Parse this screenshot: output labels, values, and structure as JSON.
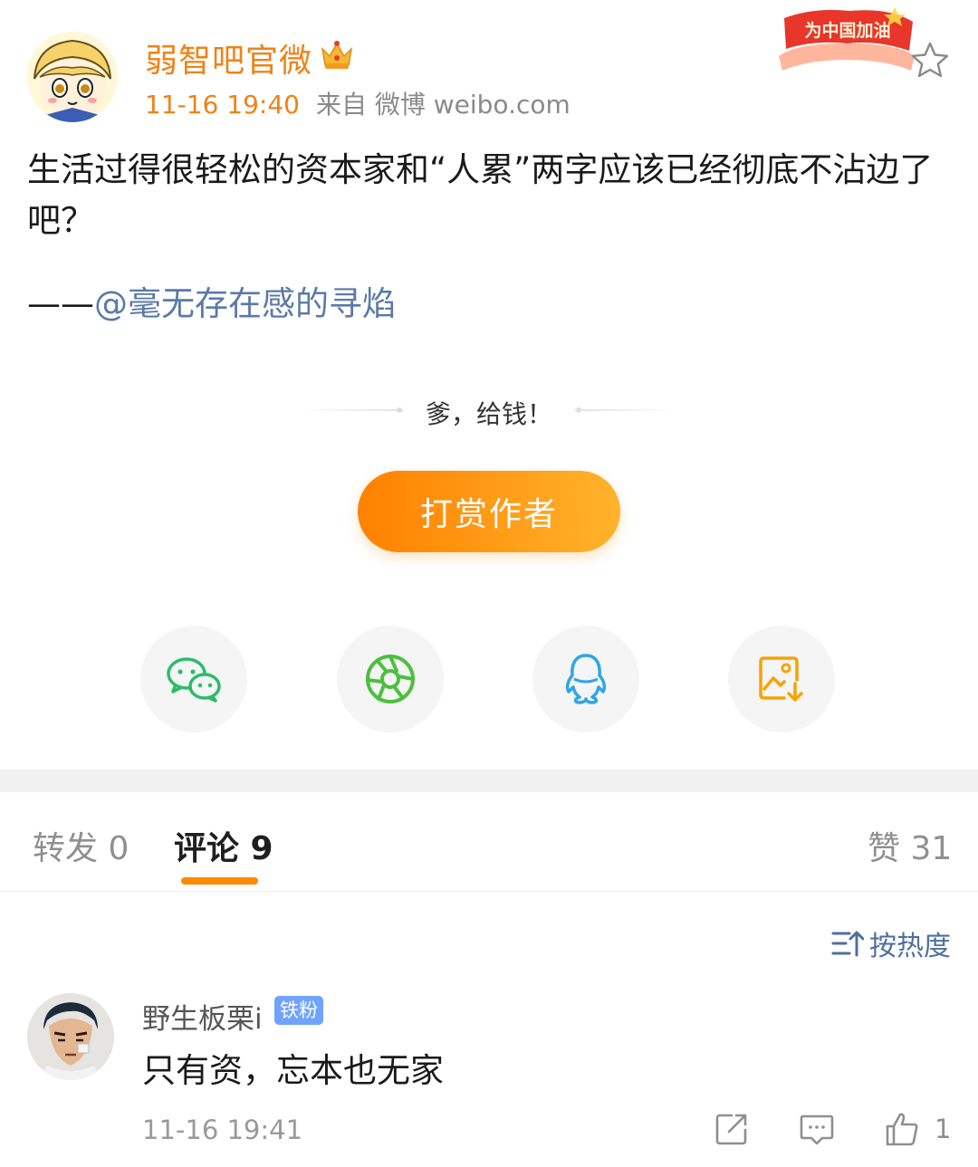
{
  "post": {
    "author": "弱智吧官微",
    "time": "11-16 19:40",
    "source": "来自 微博 weibo.com",
    "badge_text": "为中国加油",
    "text": "生活过得很轻松的资本家和“人累”两字应该已经彻底不沾边了吧？",
    "signature_dash": "——",
    "signature_mention": "@毫无存在感的寻焰"
  },
  "reward": {
    "slogan": "爹，给钱！",
    "button_label": "打赏作者"
  },
  "share": {
    "items": [
      {
        "icon": "wechat-icon",
        "color": "#2dbb6b"
      },
      {
        "icon": "moments-icon",
        "color": "#4cbf3d"
      },
      {
        "icon": "qq-icon",
        "color": "#2fa5e8"
      },
      {
        "icon": "save-image-icon",
        "color": "#f5a400"
      }
    ]
  },
  "tabs": {
    "repost": "转发 0",
    "comment": "评论 9",
    "like": "赞 31",
    "sort": "按热度"
  },
  "comments": [
    {
      "user": "野生板栗i",
      "badge": "铁粉",
      "text": "只有资，忘本也无家",
      "time": "11-16 19:41",
      "likes": "1"
    }
  ],
  "colors": {
    "accent": "#f08216",
    "link": "#5b7aa6",
    "reward_start": "#ff8100",
    "reward_end": "#ffb32c"
  }
}
